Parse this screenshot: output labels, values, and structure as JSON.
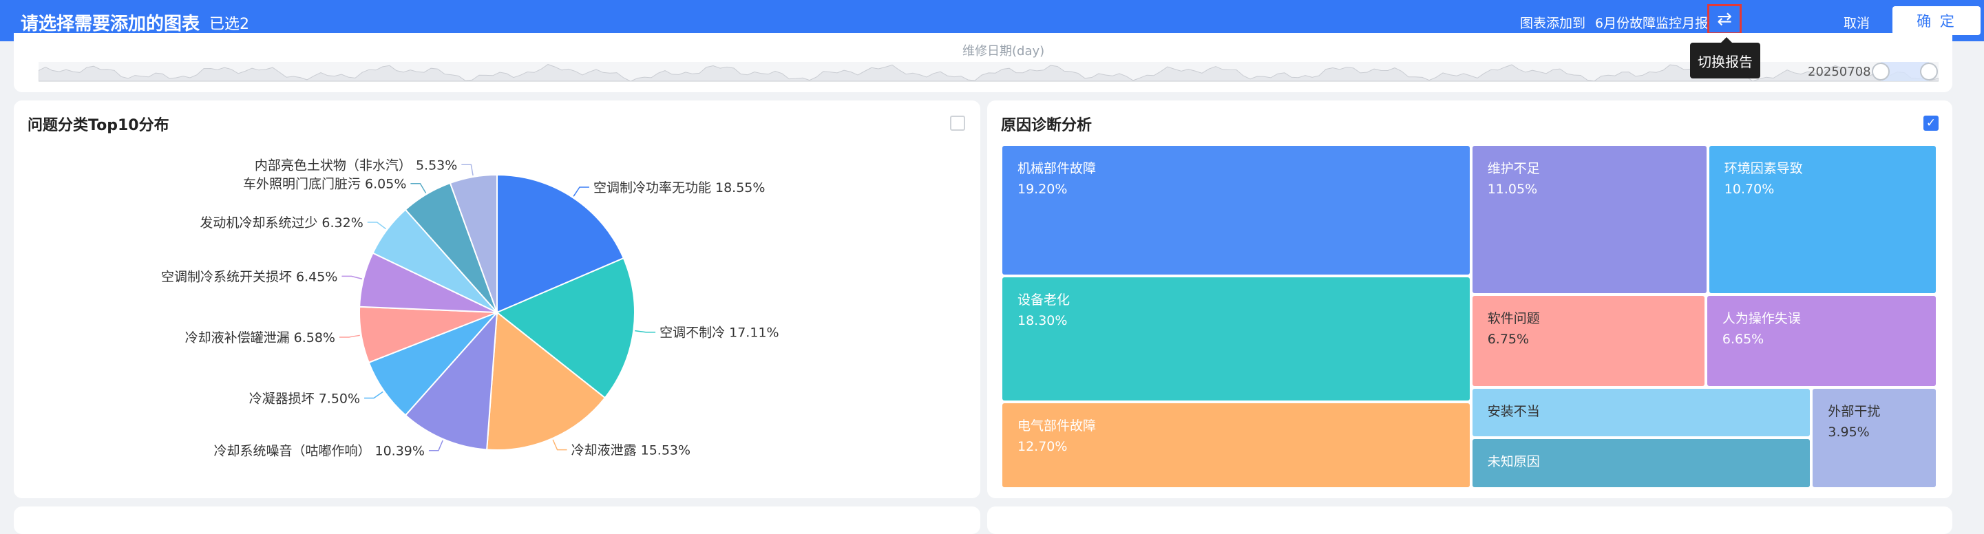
{
  "header": {
    "title": "请选择需要添加的图表",
    "selected": "已选2",
    "add_to_label": "图表添加到",
    "report_name": "6月份故障监控月报",
    "switch_icon": "⇄",
    "cancel_label": "取消",
    "confirm_label": "确 定"
  },
  "tooltip": {
    "text": "切换报告"
  },
  "timeline": {
    "axis_label": "维修日期(day)",
    "end_date": "20250708"
  },
  "pie_card": {
    "title": "问题分类Top10分布",
    "checked": false,
    "chart_data": {
      "type": "pie",
      "title": "问题分类Top10分布",
      "slices": [
        {
          "label": "空调制冷功率无功能",
          "value": 18.55,
          "display": "18.55%",
          "color": "#3d7ff5"
        },
        {
          "label": "空调不制冷",
          "value": 17.11,
          "display": "17.11%",
          "color": "#2ec9c4"
        },
        {
          "label": "冷却液泄露",
          "value": 15.53,
          "display": "15.53%",
          "color": "#ffb570"
        },
        {
          "label": "冷却系统噪音（咕嘟作响）",
          "value": 10.39,
          "display": "10.39%",
          "color": "#8f8fe8"
        },
        {
          "label": "冷凝器损坏",
          "value": 7.5,
          "display": "7.50%",
          "color": "#54b6f7"
        },
        {
          "label": "冷却液补偿罐泄漏",
          "value": 6.58,
          "display": "6.58%",
          "color": "#ff9f9a"
        },
        {
          "label": "空调制冷系统开关损坏",
          "value": 6.45,
          "display": "6.45%",
          "color": "#b98ee6"
        },
        {
          "label": "发动机冷却系统过少",
          "value": 6.32,
          "display": "6.32%",
          "color": "#8bd3f7"
        },
        {
          "label": "车外照明门底门脏污",
          "value": 6.05,
          "display": "6.05%",
          "color": "#57aac6"
        },
        {
          "label": "内部亮色土状物（非水汽）",
          "value": 5.53,
          "display": "5.53%",
          "color": "#a9b5e6"
        }
      ]
    }
  },
  "treemap_card": {
    "title": "原因诊断分析",
    "checked": true,
    "check_icon": "✓",
    "chart_data": {
      "type": "treemap",
      "title": "原因诊断分析",
      "items": [
        {
          "label": "机械部件故障",
          "value": 19.2,
          "display": "19.20%",
          "color": "#4f8ef7"
        },
        {
          "label": "设备老化",
          "value": 18.3,
          "display": "18.30%",
          "color": "#35c9c8"
        },
        {
          "label": "电气部件故障",
          "value": 12.7,
          "display": "12.70%",
          "color": "#ffb46e"
        },
        {
          "label": "维护不足",
          "value": 11.05,
          "display": "11.05%",
          "color": "#9191e6"
        },
        {
          "label": "环境因素导致",
          "value": 10.7,
          "display": "10.70%",
          "color": "#4cb3f5"
        },
        {
          "label": "软件问题",
          "value": 6.75,
          "display": "6.75%",
          "color": "#ffa39e"
        },
        {
          "label": "人为操作失误",
          "value": 6.65,
          "display": "6.65%",
          "color": "#bb8de6"
        },
        {
          "label": "安装不当",
          "value": null,
          "display": "",
          "color": "#8ed2f5"
        },
        {
          "label": "未知原因",
          "value": null,
          "display": "",
          "color": "#5aaecb"
        },
        {
          "label": "外部干扰",
          "value": 3.95,
          "display": "3.95%",
          "color": "#a8b6e8"
        }
      ]
    }
  }
}
